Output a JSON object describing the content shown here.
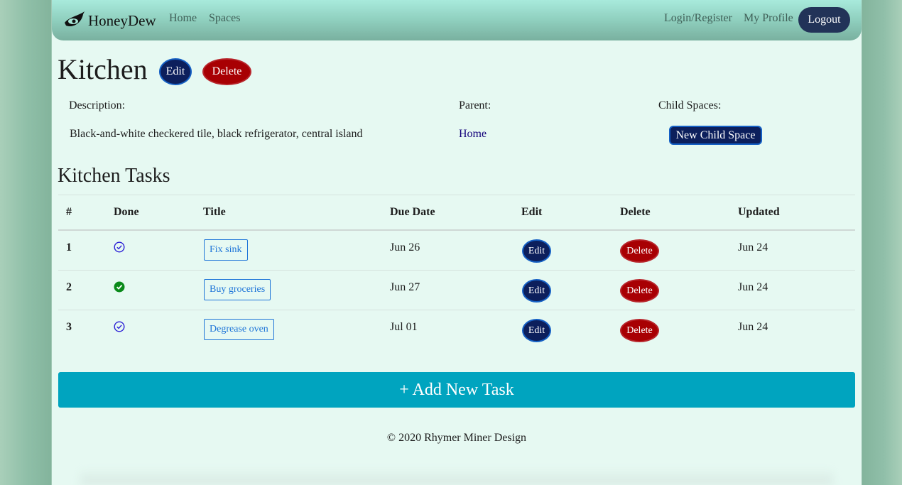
{
  "navbar": {
    "brand": "HoneyDew",
    "links": [
      "Home",
      "Spaces"
    ],
    "right_links": [
      "Login/Register",
      "My Profile"
    ],
    "logout": "Logout"
  },
  "space": {
    "title": "Kitchen",
    "edit_label": "Edit",
    "delete_label": "Delete",
    "description_label": "Description:",
    "description": "Black-and-white checkered tile, black refrigerator, central island",
    "parent_label": "Parent:",
    "parent_link": "Home",
    "child_label": "Child Spaces:",
    "new_child_button": "New Child Space"
  },
  "tasks": {
    "heading": "Kitchen Tasks",
    "columns": [
      "#",
      "Done",
      "Title",
      "Due Date",
      "Edit",
      "Delete",
      "Updated"
    ],
    "rows": [
      {
        "num": "1",
        "done": false,
        "title": "Fix sink",
        "due": "Jun 26",
        "edit": "Edit",
        "delete": "Delete",
        "updated": "Jun 24"
      },
      {
        "num": "2",
        "done": true,
        "title": "Buy groceries",
        "due": "Jun 27",
        "edit": "Edit",
        "delete": "Delete",
        "updated": "Jun 24"
      },
      {
        "num": "3",
        "done": false,
        "title": "Degrease oven",
        "due": "Jul 01",
        "edit": "Edit",
        "delete": "Delete",
        "updated": "Jun 24"
      }
    ],
    "add_button": "+ Add New Task"
  },
  "footer": {
    "text": "© 2020 Rhymer Miner Design"
  },
  "colors": {
    "primary_dark": "#0c1f5c",
    "danger": "#a80003",
    "accent_teal": "#00a4bf",
    "done_green": "#0a8a1a",
    "undone_blue": "#2b1fd6"
  }
}
